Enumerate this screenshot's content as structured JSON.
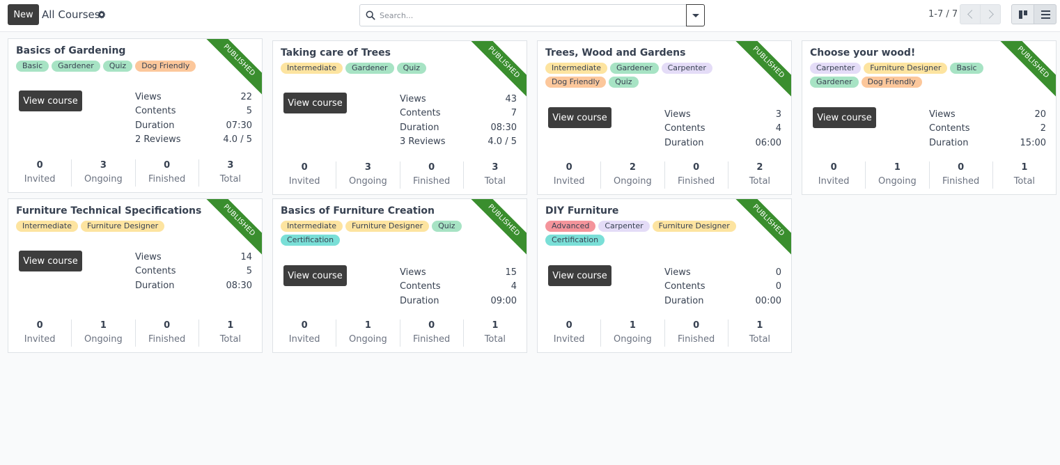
{
  "control_panel": {
    "new_label": "New",
    "breadcrumb": "All Courses",
    "search_placeholder": "Search...",
    "pager": "1-7 / 7"
  },
  "labels": {
    "views": "Views",
    "contents": "Contents",
    "duration": "Duration",
    "view_course": "View course",
    "invited": "Invited",
    "ongoing": "Ongoing",
    "finished": "Finished",
    "total": "Total",
    "ribbon": "PUBLISHED"
  },
  "tag_colors": {
    "green": "#a7e3c4",
    "yellow": "#fde4a0",
    "orange": "#fcc79b",
    "purple": "#e4dcf7",
    "red": "#f4949b",
    "teal": "#7adfd7",
    "ribbon": "#3a8e2e"
  },
  "courses": [
    {
      "title": "Basics of Gardening",
      "tags": [
        {
          "label": "Basic",
          "color": "green"
        },
        {
          "label": "Gardener",
          "color": "green"
        },
        {
          "label": "Quiz",
          "color": "green"
        },
        {
          "label": "Dog Friendly",
          "color": "orange"
        }
      ],
      "views": "22",
      "contents": "5",
      "duration": "07:30",
      "reviews_label": "2 Reviews",
      "rating": "4.0 / 5",
      "invited": "0",
      "ongoing": "3",
      "finished": "0",
      "total": "3"
    },
    {
      "title": "Taking care of Trees",
      "tags": [
        {
          "label": "Intermediate",
          "color": "yellow"
        },
        {
          "label": "Gardener",
          "color": "green"
        },
        {
          "label": "Quiz",
          "color": "green"
        }
      ],
      "views": "43",
      "contents": "7",
      "duration": "08:30",
      "reviews_label": "3 Reviews",
      "rating": "4.0 / 5",
      "invited": "0",
      "ongoing": "3",
      "finished": "0",
      "total": "3"
    },
    {
      "title": "Trees, Wood and Gardens",
      "tags": [
        {
          "label": "Intermediate",
          "color": "yellow"
        },
        {
          "label": "Gardener",
          "color": "green"
        },
        {
          "label": "Carpenter",
          "color": "purple"
        },
        {
          "label": "Dog Friendly",
          "color": "orange"
        },
        {
          "label": "Quiz",
          "color": "green"
        }
      ],
      "views": "3",
      "contents": "4",
      "duration": "06:00",
      "invited": "0",
      "ongoing": "2",
      "finished": "0",
      "total": "2"
    },
    {
      "title": "Choose your wood!",
      "tags": [
        {
          "label": "Carpenter",
          "color": "purple"
        },
        {
          "label": "Furniture Designer",
          "color": "yellow"
        },
        {
          "label": "Basic",
          "color": "green"
        },
        {
          "label": "Gardener",
          "color": "green"
        },
        {
          "label": "Dog Friendly",
          "color": "orange"
        }
      ],
      "views": "20",
      "contents": "2",
      "duration": "15:00",
      "invited": "0",
      "ongoing": "1",
      "finished": "0",
      "total": "1"
    },
    {
      "title": "Furniture Technical Specifications",
      "tags": [
        {
          "label": "Intermediate",
          "color": "yellow"
        },
        {
          "label": "Furniture Designer",
          "color": "yellow"
        }
      ],
      "views": "14",
      "contents": "5",
      "duration": "08:30",
      "invited": "0",
      "ongoing": "1",
      "finished": "0",
      "total": "1"
    },
    {
      "title": "Basics of Furniture Creation",
      "tags": [
        {
          "label": "Intermediate",
          "color": "yellow"
        },
        {
          "label": "Furniture Designer",
          "color": "yellow"
        },
        {
          "label": "Quiz",
          "color": "green"
        },
        {
          "label": "Certification",
          "color": "teal"
        }
      ],
      "views": "15",
      "contents": "4",
      "duration": "09:00",
      "invited": "0",
      "ongoing": "1",
      "finished": "0",
      "total": "1"
    },
    {
      "title": "DIY Furniture",
      "tags": [
        {
          "label": "Advanced",
          "color": "red"
        },
        {
          "label": "Carpenter",
          "color": "purple"
        },
        {
          "label": "Furniture Designer",
          "color": "yellow"
        },
        {
          "label": "Certification",
          "color": "teal"
        }
      ],
      "views": "0",
      "contents": "0",
      "duration": "00:00",
      "invited": "0",
      "ongoing": "1",
      "finished": "0",
      "total": "1"
    }
  ]
}
